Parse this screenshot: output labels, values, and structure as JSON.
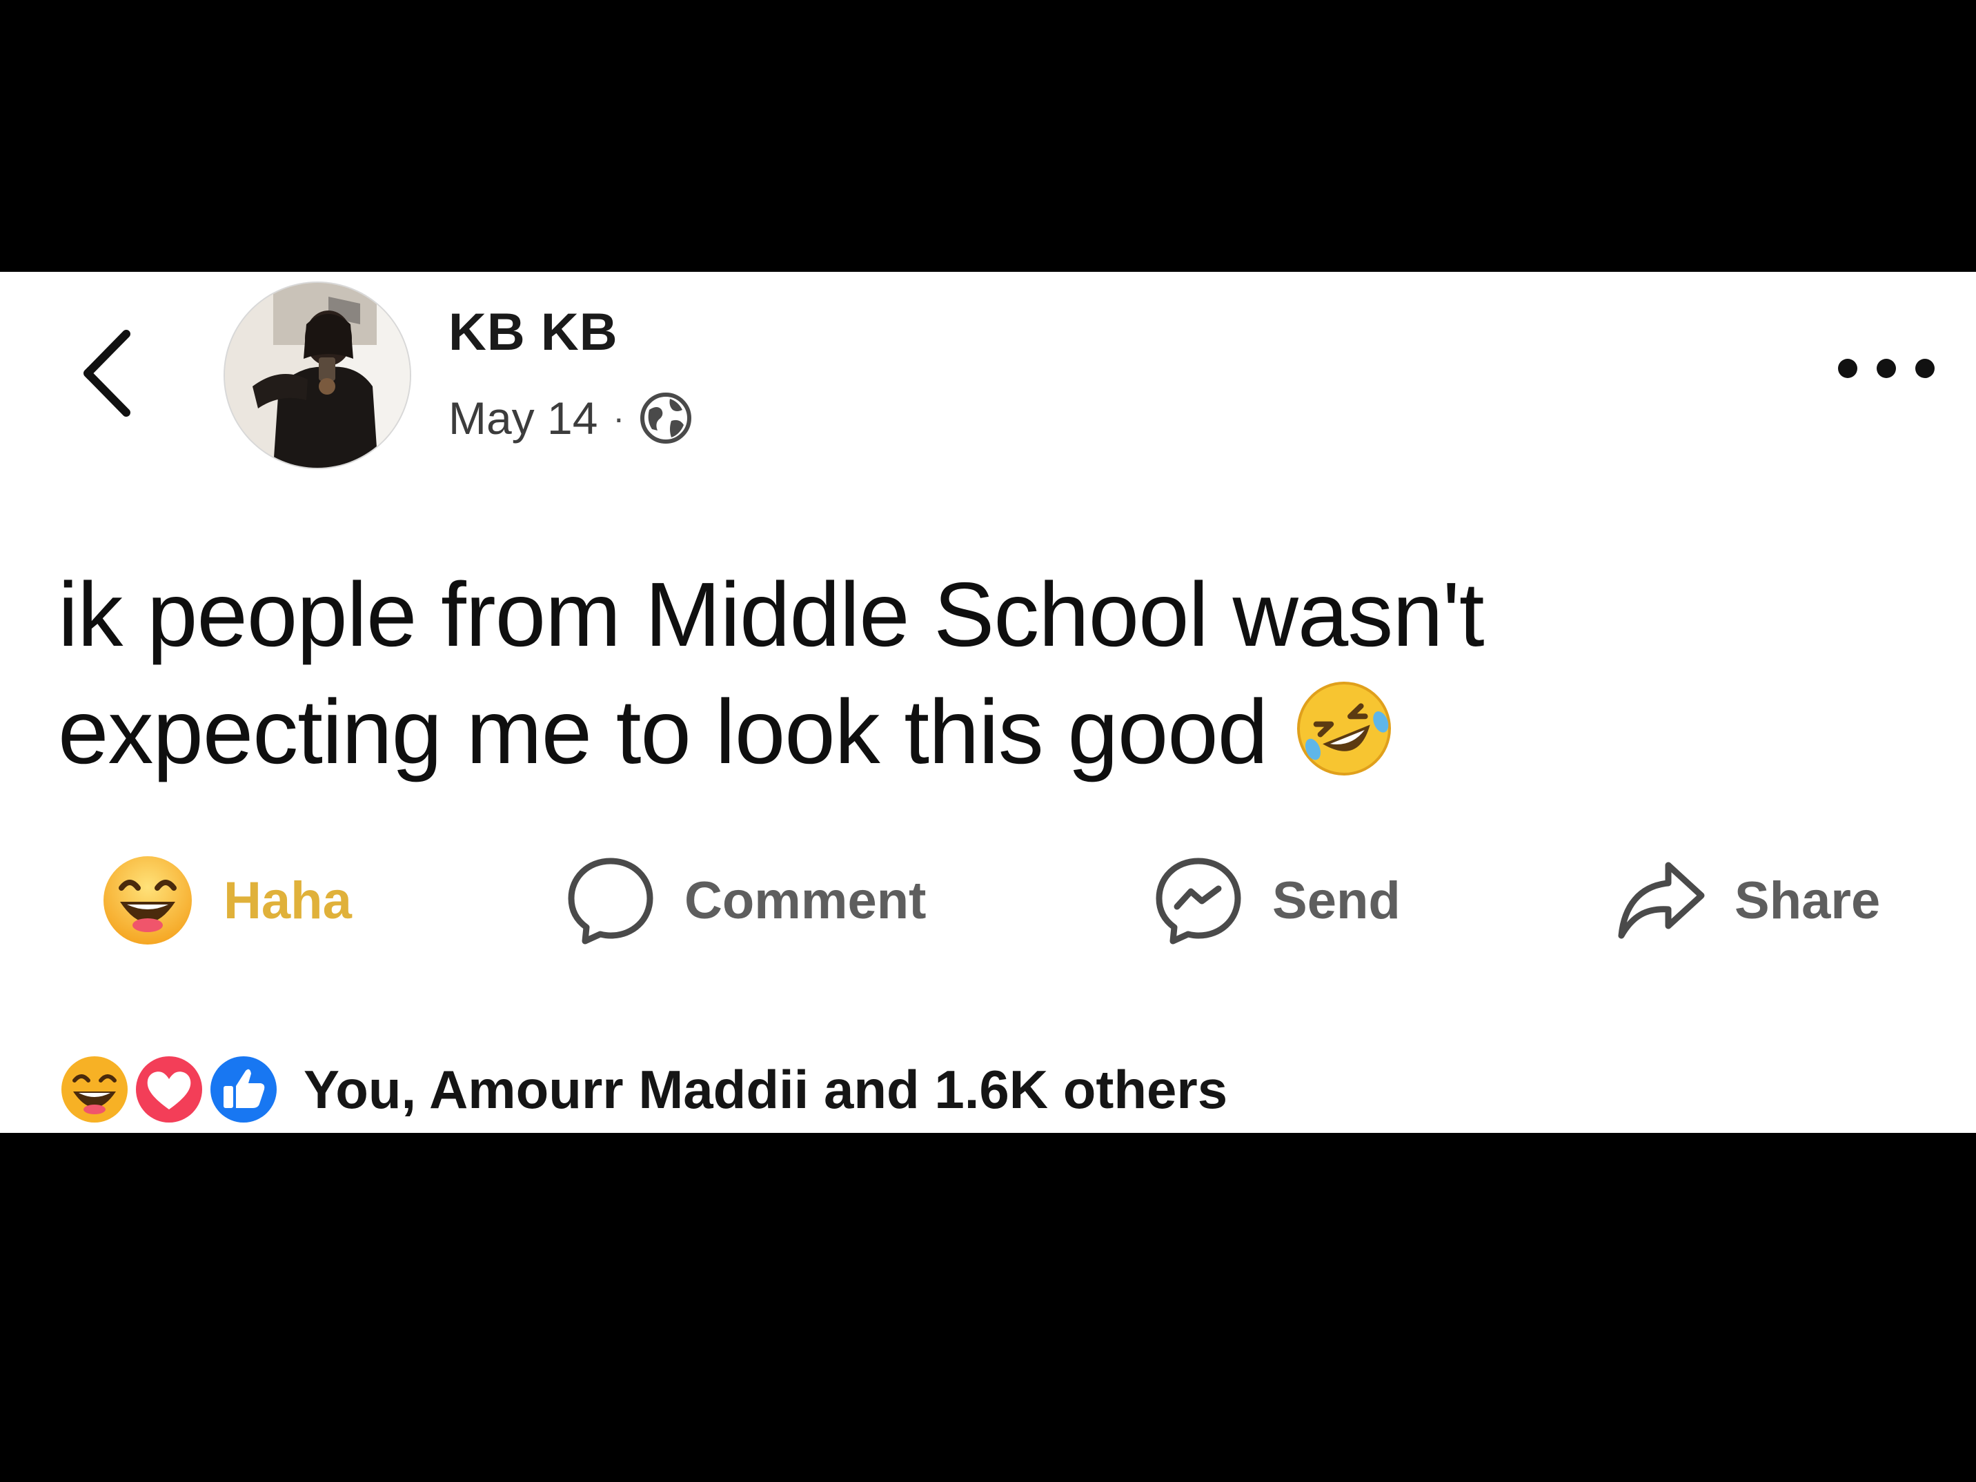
{
  "post": {
    "author": "KB KB",
    "date": "May 14",
    "separator": "·",
    "text": "ik people from Middle School wasn't expecting me to look this good"
  },
  "actions": [
    {
      "label": "Haha",
      "icon": "haha-reaction-icon",
      "color": "#e0b13a"
    },
    {
      "label": "Comment",
      "icon": "comment-bubble-icon"
    },
    {
      "label": "Send",
      "icon": "messenger-icon"
    },
    {
      "label": "Share",
      "icon": "share-arrow-icon"
    }
  ],
  "reactions": {
    "summary": "You, Amourr Maddii and 1.6K others",
    "icons": [
      "haha-reaction-icon",
      "love-reaction-icon",
      "like-reaction-icon"
    ]
  },
  "colors": {
    "like_blue": "#1877f2",
    "love_pink": "#f33e58",
    "haha_yellow": "#f7b125",
    "text_dark": "#0f0f0f"
  }
}
